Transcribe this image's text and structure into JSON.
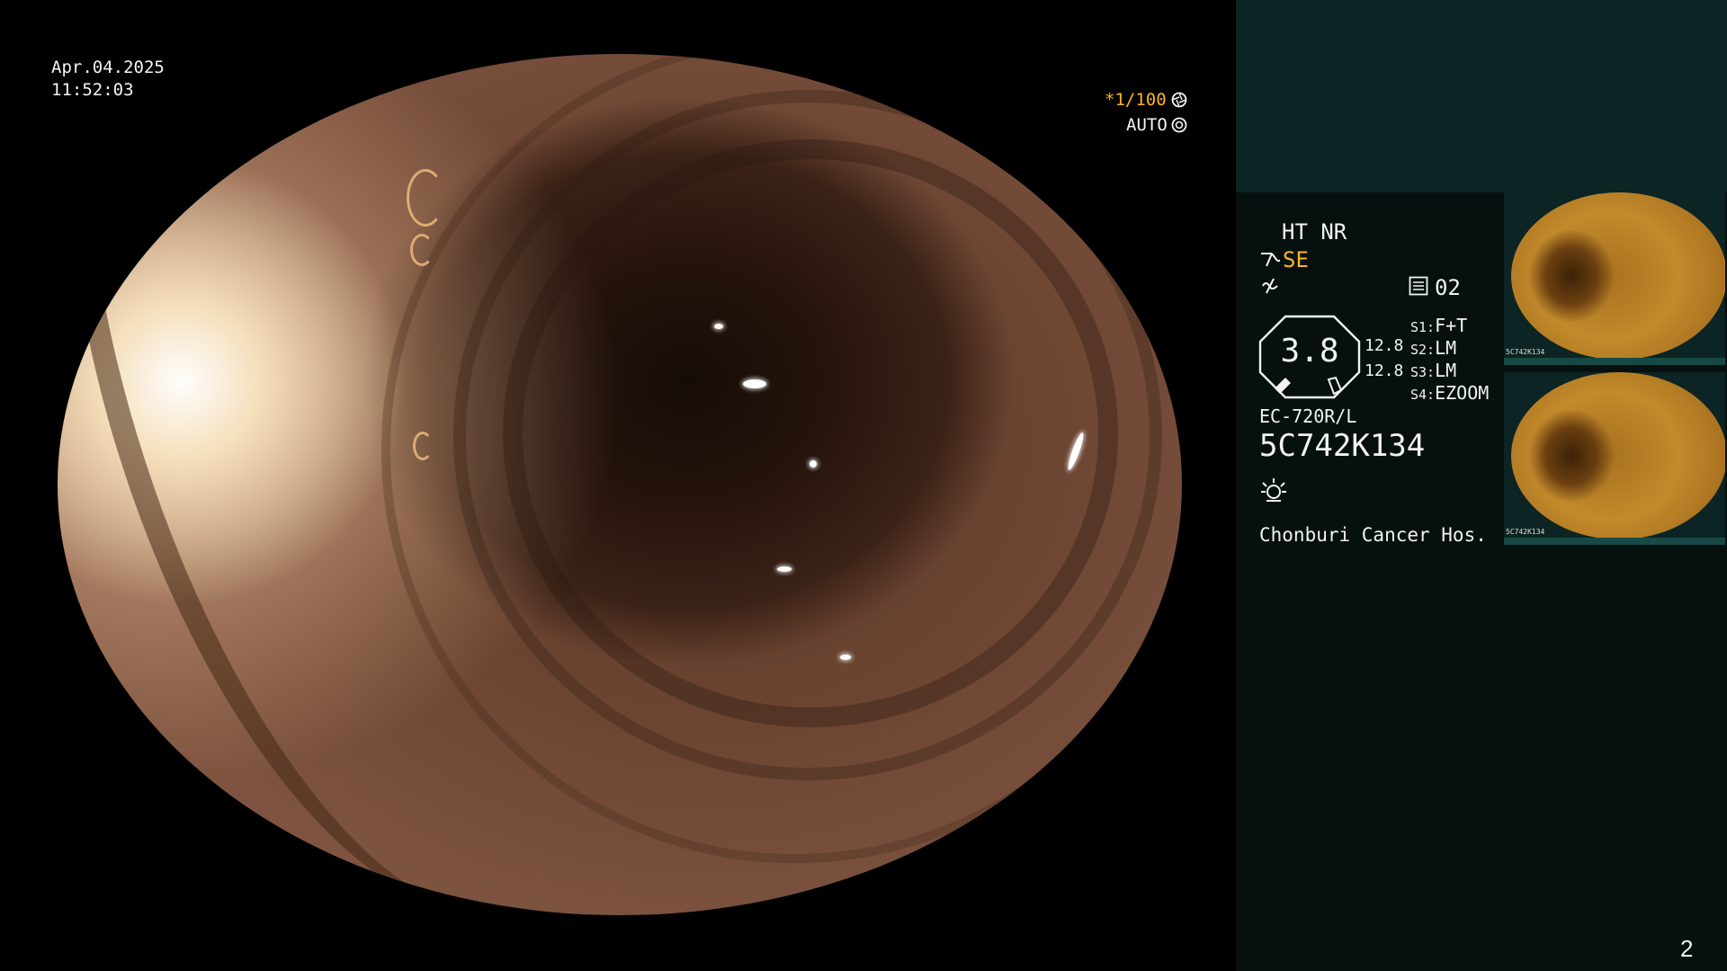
{
  "overlay": {
    "date": "Apr.04.2025",
    "time": "11:52:03",
    "shutter": "*1/100",
    "exposure_mode": "AUTO"
  },
  "panel": {
    "enhancement": "HT NR",
    "mode": "SE",
    "record_label": "02",
    "ratio_value": "3.8",
    "values": [
      "12.8",
      "12.8"
    ],
    "switches": [
      {
        "key": "S1:",
        "value": "F+T"
      },
      {
        "key": "S2:",
        "value": "LM"
      },
      {
        "key": "S3:",
        "value": "LM"
      },
      {
        "key": "S4:",
        "value": "EZOOM"
      }
    ],
    "scope_model": "EC-720R/L",
    "serial": "5C742K134",
    "hospital": "Chonburi Cancer Hos.",
    "page_number": "2",
    "thumb_caption": "5C742K134"
  },
  "icons": {
    "shutter": "aperture-icon",
    "auto": "iris-icon",
    "mode": "scope-icon",
    "freeze": "freeze-icon",
    "record": "record-icon",
    "light": "light-icon"
  },
  "colors": {
    "accent": "#ffb320",
    "panel_bg": "#06110f",
    "panel_top": "#0c2423"
  }
}
